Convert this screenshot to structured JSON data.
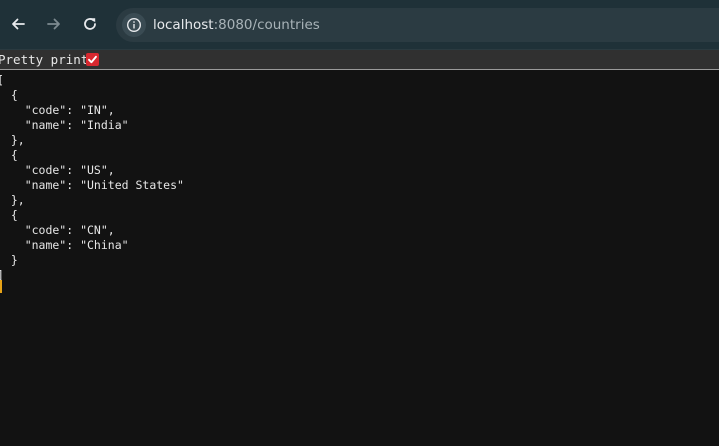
{
  "browser": {
    "url_host": "localhost",
    "url_rest": ":8080/countries",
    "icons": {
      "back": "arrow-left-icon",
      "forward": "arrow-right-icon",
      "reload": "reload-icon",
      "site_info": "info-icon"
    }
  },
  "pretty_print": {
    "label": "Pretty print",
    "checked": true,
    "accent_color": "#d7282f"
  },
  "json": {
    "lines": [
      "[",
      "  {",
      "    \"code\": \"IN\",",
      "    \"name\": \"India\"",
      "  },",
      "  {",
      "    \"code\": \"US\",",
      "    \"name\": \"United States\"",
      "  },",
      "  {",
      "    \"code\": \"CN\",",
      "    \"name\": \"China\"",
      "  }",
      "]"
    ]
  }
}
